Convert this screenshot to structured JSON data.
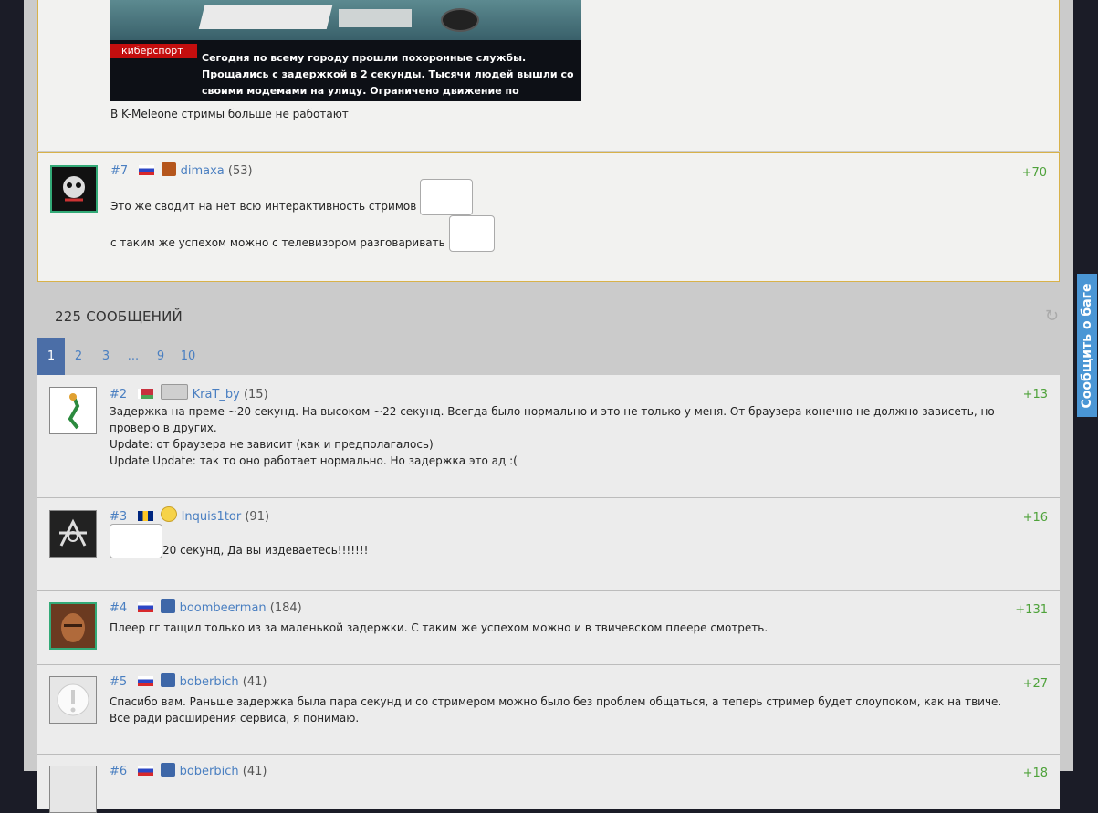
{
  "top_post": {
    "video_tag": "киберспорт",
    "video_caption": "Сегодня по всему городу прошли похоронные службы. Прощались с задержкой в 2 секунды. Тысячи людей вышли со своими модемами на улицу. Ограничено движение по садовому кольцу.",
    "text": "В K-Meleone стримы больше не работают"
  },
  "post7": {
    "num": "#7",
    "user": "dimaxa",
    "count": "(53)",
    "score": "+70",
    "line1": "Это же сводит на нет всю интерактивность стримов",
    "line2": "с таким же успехом можно с телевизором разговаривать"
  },
  "section": {
    "title": "225 СООБЩЕНИЙ"
  },
  "pager": [
    "1",
    "2",
    "3",
    "...",
    "9",
    "10"
  ],
  "comments": [
    {
      "num": "#2",
      "user": "KraT_by",
      "count": "(15)",
      "score": "+13",
      "lines": [
        "Задержка на преме ~20 секунд. На высоком ~22 секунд. Всегда было нормально и это не только у меня. От браузера конечно не должно зависеть, но проверю в других.",
        "Update: от браузера не зависит (как и предполагалось)",
        "Update Update: так то оно работает нормально. Но задержка это ад :("
      ]
    },
    {
      "num": "#3",
      "user": "Inquis1tor",
      "count": "(91)",
      "score": "+16",
      "lines": [
        "20 секунд, Да вы издеваетесь!!!!!!!"
      ]
    },
    {
      "num": "#4",
      "user": "boombeerman",
      "count": "(184)",
      "score": "+131",
      "lines": [
        "Плеер гг тащил только из за маленькой задержки. С таким же успехом можно и в твичевском плеере смотреть."
      ]
    },
    {
      "num": "#5",
      "user": "boberbich",
      "count": "(41)",
      "score": "+27",
      "lines": [
        "Спасибо вам. Раньше задержка была пара секунд и со стримером можно было без проблем общаться, а теперь стример будет слоупоком, как на твиче. Все ради расширения сервиса, я понимаю."
      ]
    },
    {
      "num": "#6",
      "user": "boberbich",
      "count": "(41)",
      "score": "+18"
    }
  ],
  "bug_report": "Сообщить о баге",
  "colors": {
    "accent": "#4a7fc1",
    "score": "#4ea23a",
    "frame": "#d8b24a",
    "pager_active": "#4b6ea7"
  }
}
